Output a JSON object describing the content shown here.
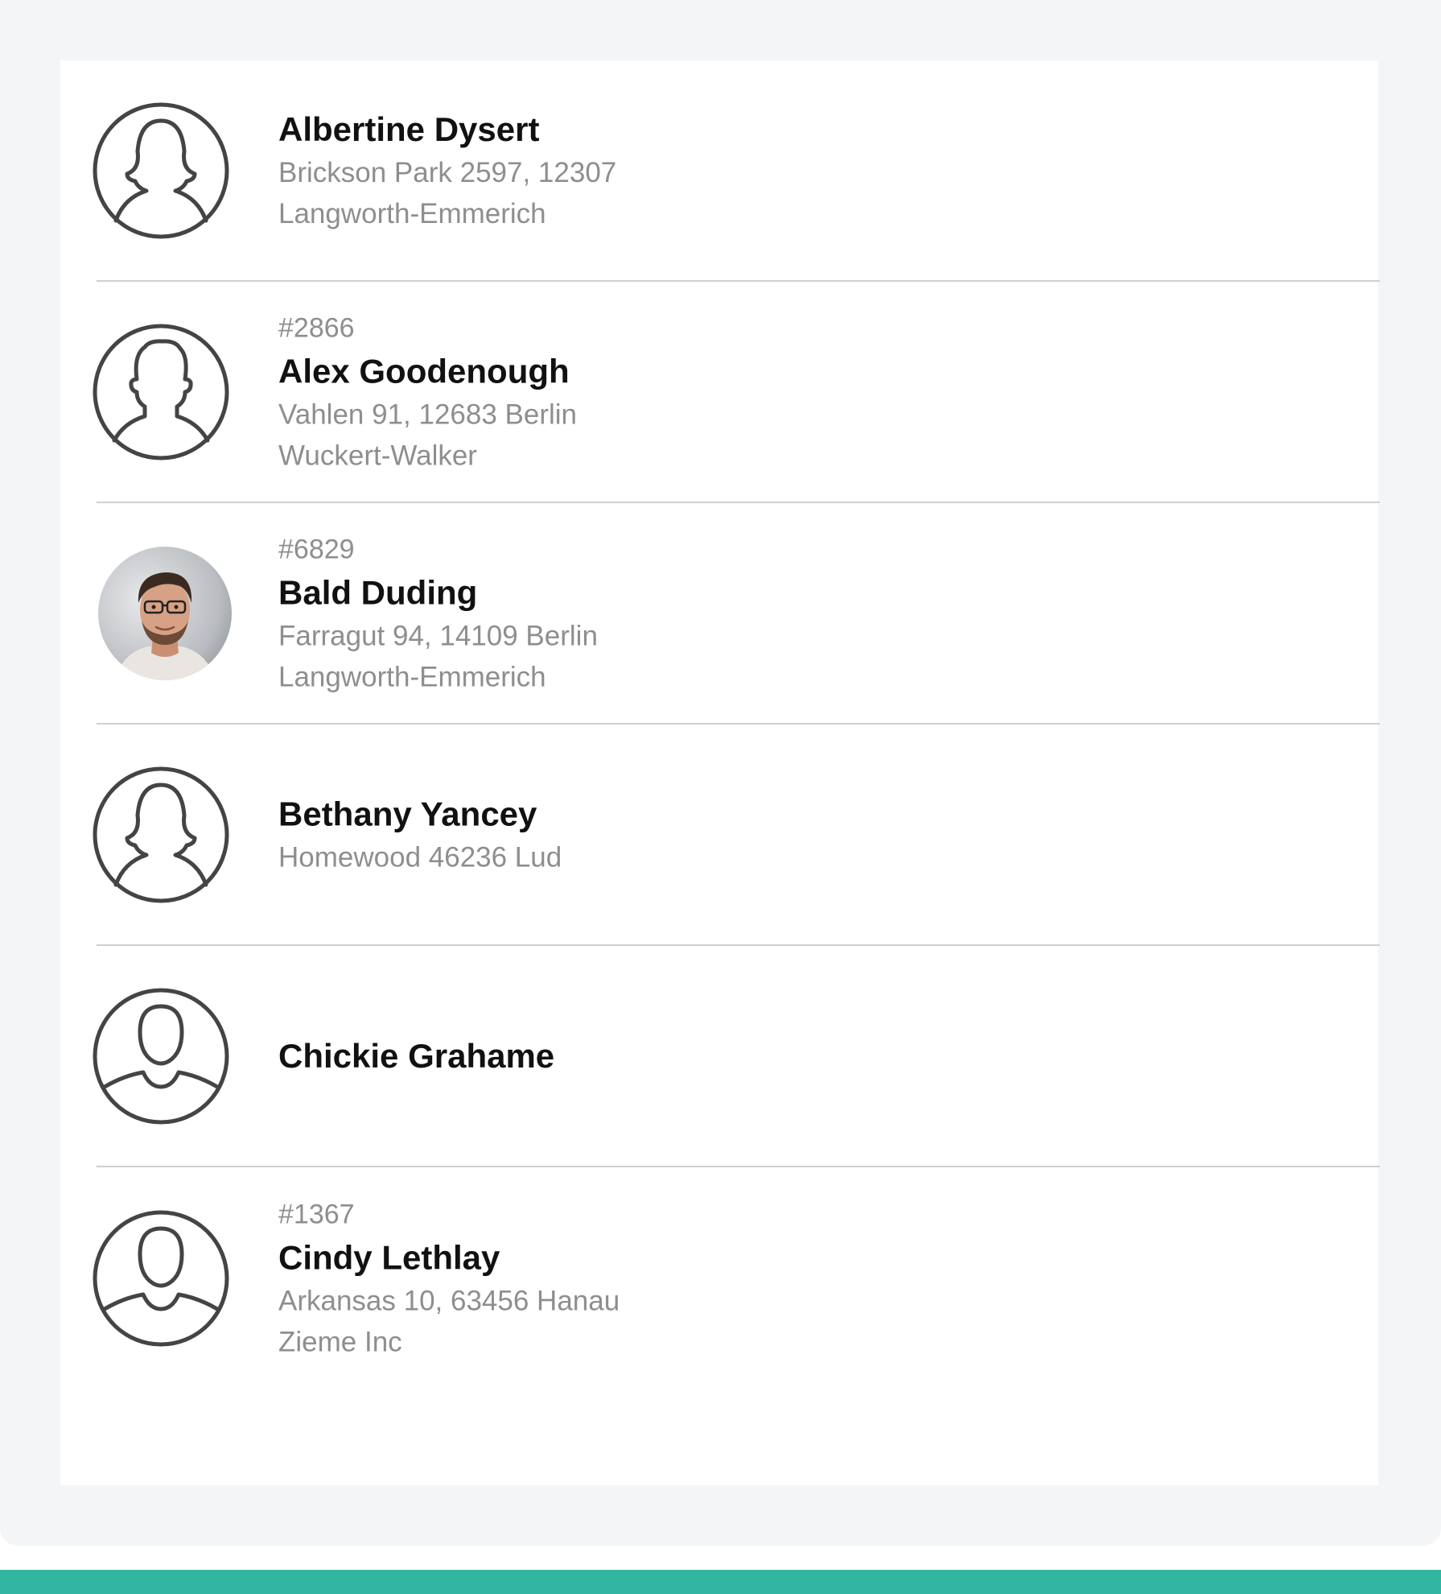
{
  "contacts": [
    {
      "number": "",
      "name": "Albertine Dysert",
      "address": "Brickson Park 2597, 12307",
      "company": "Langworth-Emmerich",
      "avatar": "female-user-icon"
    },
    {
      "number": "#2866",
      "name": "Alex Goodenough",
      "address": "Vahlen 91, 12683 Berlin",
      "company": "Wuckert-Walker",
      "avatar": "male-user-icon"
    },
    {
      "number": "#6829",
      "name": "Bald Duding",
      "address": "Farragut 94, 14109 Berlin",
      "company": "Langworth-Emmerich",
      "avatar": "profile-photo"
    },
    {
      "number": "",
      "name": "Bethany Yancey",
      "address": "Homewood 46236 Lud",
      "company": "",
      "avatar": "female-user-icon"
    },
    {
      "number": "",
      "name": "Chickie Grahame",
      "address": "",
      "company": "",
      "avatar": "user-icon"
    },
    {
      "number": "#1367",
      "name": "Cindy Lethlay",
      "address": "Arkansas 10, 63456 Hanau",
      "company": "Zieme Inc",
      "avatar": "user-icon"
    }
  ],
  "colors": {
    "accent": "#33b6a1",
    "background": "#f4f5f7",
    "card": "#ffffff",
    "divider": "#cfcfd2",
    "name_text": "#111111",
    "secondary_text": "#8e8e91",
    "icon_stroke": "#444444"
  }
}
